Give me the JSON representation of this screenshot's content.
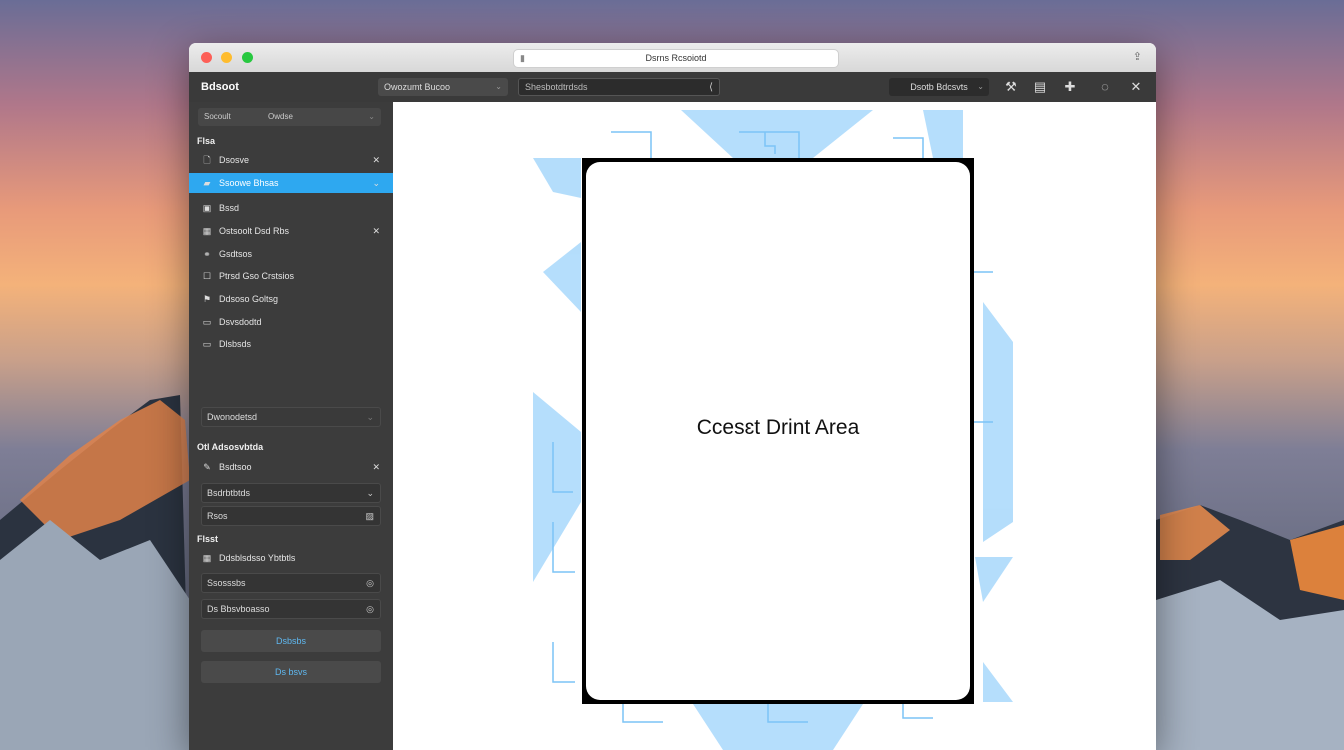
{
  "window": {
    "url": "Dsrns Rcsoiotd"
  },
  "toolbar": {
    "app_name": "Bdsoot",
    "view_select": "Owozumt Bucoo",
    "search_placeholder": "Shesbotdtrdsds",
    "action_label": "Dsotb Bdcsvts"
  },
  "sidebar": {
    "top_select": {
      "left": "Socoult",
      "right": "Owdse"
    },
    "section_files": "Flsa",
    "items": [
      {
        "label": "Dsosve",
        "icon": "file-icon",
        "closable": true
      },
      {
        "label": "Ssoowe Bhsas",
        "icon": "layer-icon",
        "closable": true,
        "selected": true
      },
      {
        "label": "Bssd",
        "icon": "file-icon",
        "closable": false
      },
      {
        "label": "Ostsoolt Dsd Rbs",
        "icon": "grid-icon",
        "closable": true
      },
      {
        "label": "Gsdtsos",
        "icon": "link-icon",
        "closable": false
      },
      {
        "label": "Ptrsd Gso Crstsios",
        "icon": "box-icon",
        "closable": false
      },
      {
        "label": "Ddsoso Goltsg",
        "icon": "flag-icon",
        "closable": false
      },
      {
        "label": "Dsvsdodtd",
        "icon": "card-icon",
        "closable": false
      },
      {
        "label": "Dlsbsds",
        "icon": "card-icon",
        "closable": false
      }
    ],
    "group_select": "Dwonodetsd",
    "section_adjust": "Otl Adsosvbtda",
    "adjust_item": "Bsdtsoo",
    "field_1": "Bsdrbtbtds",
    "field_2": "Rsos",
    "section_print": "Flsst",
    "print_item": "Ddsblsdsso Ybtbtls",
    "field_3": "Ssosssbs",
    "field_4": "Ds Bbsvboasso",
    "button_1": "Dsbsbs",
    "button_2": "Ds bsvs"
  },
  "canvas": {
    "print_label": "Ccesɛt Drint Area"
  },
  "colors": {
    "accent": "#2ea8f0",
    "pattern": "#a8d8fb"
  }
}
